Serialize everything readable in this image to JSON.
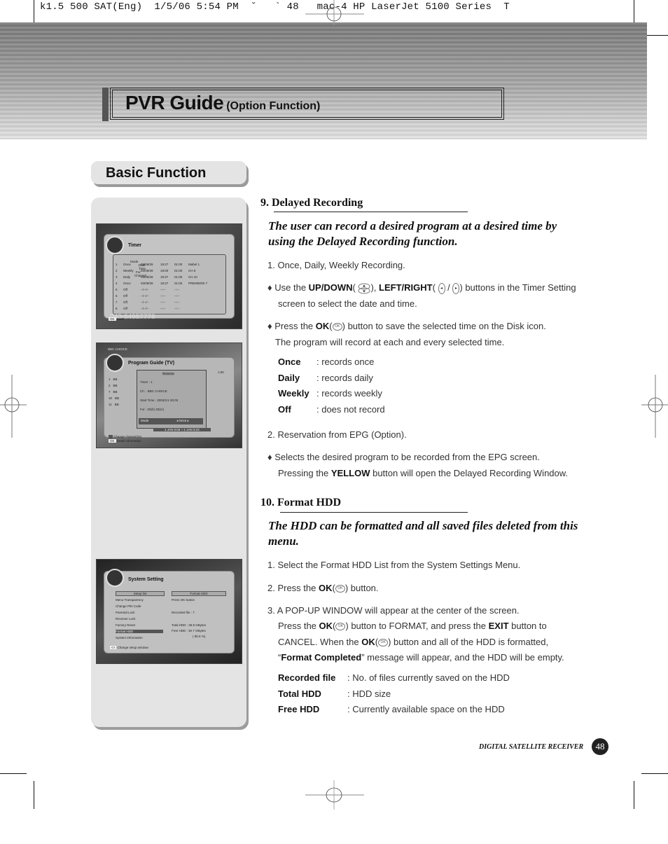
{
  "print_slug": "k1.5 500 SAT(Eng)  1/5/06 5:54 PM  ˘   ` 48   mac-4 HP LaserJet 5100 Series  T",
  "header": {
    "title": "PVR Guide",
    "subtitle": "(Option Function)"
  },
  "section_tab": "Basic Function",
  "screens": {
    "timer": {
      "title": "Timer",
      "columns": [
        "Mode",
        "Date",
        "Time",
        "For",
        "Channel"
      ],
      "rows": [
        [
          "1",
          "Once",
          "03/09/28",
          "19:27",
          "01:00",
          "Mabel 1"
        ],
        [
          "2",
          "Weekly",
          "03/09/28",
          "19:00",
          "01:00",
          "CH 8"
        ],
        [
          "3",
          "Daily",
          "03/09/28",
          "19:27",
          "01:00",
          "CH 10"
        ],
        [
          "4",
          "Once",
          "03/09/28",
          "19:27",
          "01:00",
          "PREMIERE 7"
        ],
        [
          "5",
          "Off",
          "--/--/--",
          "--:--",
          "--:--",
          ""
        ],
        [
          "6",
          "Off",
          "--/--/--",
          "--:--",
          "--:--",
          ""
        ],
        [
          "7",
          "Off",
          "--/--/--",
          "--:--",
          "--:--",
          ""
        ],
        [
          "8",
          "Off",
          "--/--/--",
          "--:--",
          "--:--",
          ""
        ]
      ],
      "overlay_number": "040-64957778",
      "footer": "Save"
    },
    "epg": {
      "top_label": "BBC CHOICE",
      "title": "Program Guide (TV)",
      "popup_title": "Reserve",
      "popup_lines": [
        "Timer : 1",
        "Ch. : BBC CHOICE",
        "Start Time : 2003/1/1 00:03",
        "For : 00(h) 20(m)"
      ],
      "mode_label": "Mode",
      "mode_value": "◂ Once ▸",
      "time_range": "1 JAN 0:03 ~ 1 JAN 0:23",
      "list_numbers": [
        "1",
        "2",
        "7",
        "10",
        "11"
      ],
      "list_prefix": "BB",
      "header_time": "1:00",
      "footer_lines": [
        "Change channel list",
        "Detail information"
      ]
    },
    "system": {
      "title": "System Setting",
      "left_header": "Setup list",
      "right_header": "Format HDD",
      "menu": [
        "Menu Transparency",
        "Change PIN Code",
        "Parental Lock",
        "Receiver Lock",
        "Factory Reset",
        "Format HDD",
        "System Information"
      ],
      "selected_index": 5,
      "info": [
        "Press OK button",
        "Recorded file : 7",
        "Total HDD : 35.9 GBytes",
        "Free HDD : 30.7 GBytes",
        "( 85.5 %)"
      ],
      "footer": "Change setup window"
    }
  },
  "section9": {
    "heading": "9. Delayed Recording",
    "lead": "The user can record a desired program at a desired time by using the Delayed Recording function.",
    "item1": "1. Once, Daily, Weekly Recording.",
    "bullet1": {
      "pre": "♦ Use the ",
      "b1": "UP/DOWN",
      "mid1": "), ",
      "b2": "LEFT/RIGHT",
      "post": ") buttons in the Timer Setting",
      "line2": "screen to select the date and time."
    },
    "bullet2": {
      "pre": "♦ Press the ",
      "b1": "OK",
      "post": ") button to save the selected time on the Disk icon.",
      "line2": "The program will record at each and every selected time."
    },
    "modes": [
      {
        "key": "Once",
        "value": ": records once"
      },
      {
        "key": "Daily",
        "value": ": records daily"
      },
      {
        "key": "Weekly",
        "value": ": records weekly"
      },
      {
        "key": "Off",
        "value": ": does not record"
      }
    ],
    "item2": "2. Reservation from EPG (Option).",
    "bullet3": {
      "line1": "♦ Selects the desired program to be recorded from the EPG screen.",
      "pre": "Pressing the ",
      "b1": "YELLOW",
      "post": " button will open the Delayed Recording Window."
    }
  },
  "section10": {
    "heading": "10. Format HDD",
    "lead": "The HDD can be formatted and all saved files deleted from this menu.",
    "item1": "1. Select the Format HDD List from the System Settings Menu.",
    "item2": {
      "pre": "2. Press the ",
      "b1": "OK",
      "post": ") button."
    },
    "item3": {
      "line1": "3. A POP-UP WINDOW will appear at the center of the screen.",
      "l2_pre": "Press the ",
      "l2_b1": "OK",
      "l2_mid": ") button to FORMAT, and press the ",
      "l2_b2": "EXIT",
      "l2_post": " button to",
      "l3_pre": "CANCEL. When the ",
      "l3_b1": "OK",
      "l3_post": ") button and all of the HDD is formatted,",
      "l4_open": "“",
      "l4_b1": "Format Completed",
      "l4_post": "” message will appear, and the HDD will be empty."
    },
    "fields": [
      {
        "key": "Recorded file",
        "value": ": No. of files currently saved on the HDD"
      },
      {
        "key": "Total HDD",
        "value": ": HDD size"
      },
      {
        "key": "Free HDD",
        "value": ": Currently available space on the HDD"
      }
    ]
  },
  "footer": {
    "label": "DIGITAL SATELLITE RECEIVER",
    "page_number": "48"
  },
  "icons": {
    "ok": "OK",
    "left": "◂",
    "right": "▸"
  }
}
